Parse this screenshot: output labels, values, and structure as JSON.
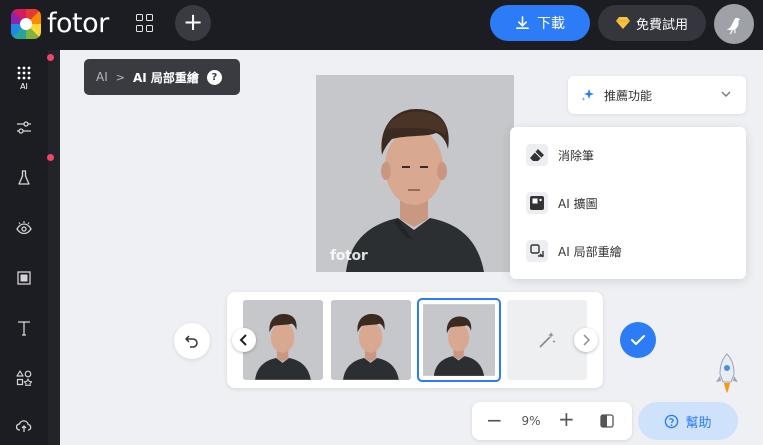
{
  "brand": {
    "logo_text": "fotor"
  },
  "header": {
    "download_label": "下載",
    "trial_label": "免費試用",
    "plus_label": "+"
  },
  "sidebar": {
    "items": [
      {
        "name": "ai",
        "label": "AI",
        "icon": "dots-grid-icon",
        "active": true,
        "dot": true
      },
      {
        "name": "adjust",
        "label": "",
        "icon": "sliders-icon",
        "dot": false
      },
      {
        "name": "beauty",
        "label": "",
        "icon": "flask-icon",
        "dot": true
      },
      {
        "name": "eye",
        "label": "",
        "icon": "eye-icon",
        "dot": false
      },
      {
        "name": "frame",
        "label": "",
        "icon": "frame-icon",
        "dot": false
      },
      {
        "name": "text",
        "label": "",
        "icon": "text-icon",
        "dot": false
      },
      {
        "name": "elements",
        "label": "",
        "icon": "shapes-icon",
        "dot": false
      },
      {
        "name": "upload",
        "label": "",
        "icon": "cloud-upload-icon",
        "dot": false
      }
    ]
  },
  "breadcrumb": {
    "root": "AI",
    "separator": ">",
    "current": "AI 局部重繪",
    "help": "?"
  },
  "photo": {
    "watermark": "fotor"
  },
  "feature_select": {
    "label": "推薦功能"
  },
  "dropdown": {
    "items": [
      {
        "label": "消除筆",
        "icon": "eraser-icon"
      },
      {
        "label": "AI 擴圖",
        "icon": "expand-image-icon"
      },
      {
        "label": "AI 局部重繪",
        "icon": "inpaint-icon"
      }
    ]
  },
  "thumbnails": {
    "count": 3,
    "selected_index": 2
  },
  "zoom": {
    "value": "9%",
    "minus": "−",
    "plus": "+"
  },
  "help_button": {
    "label": "幫助"
  },
  "colors": {
    "accent": "#2b7cf6",
    "topbar": "#1c1d22",
    "canvas": "#eef0f3",
    "notification": "#f2456b"
  }
}
